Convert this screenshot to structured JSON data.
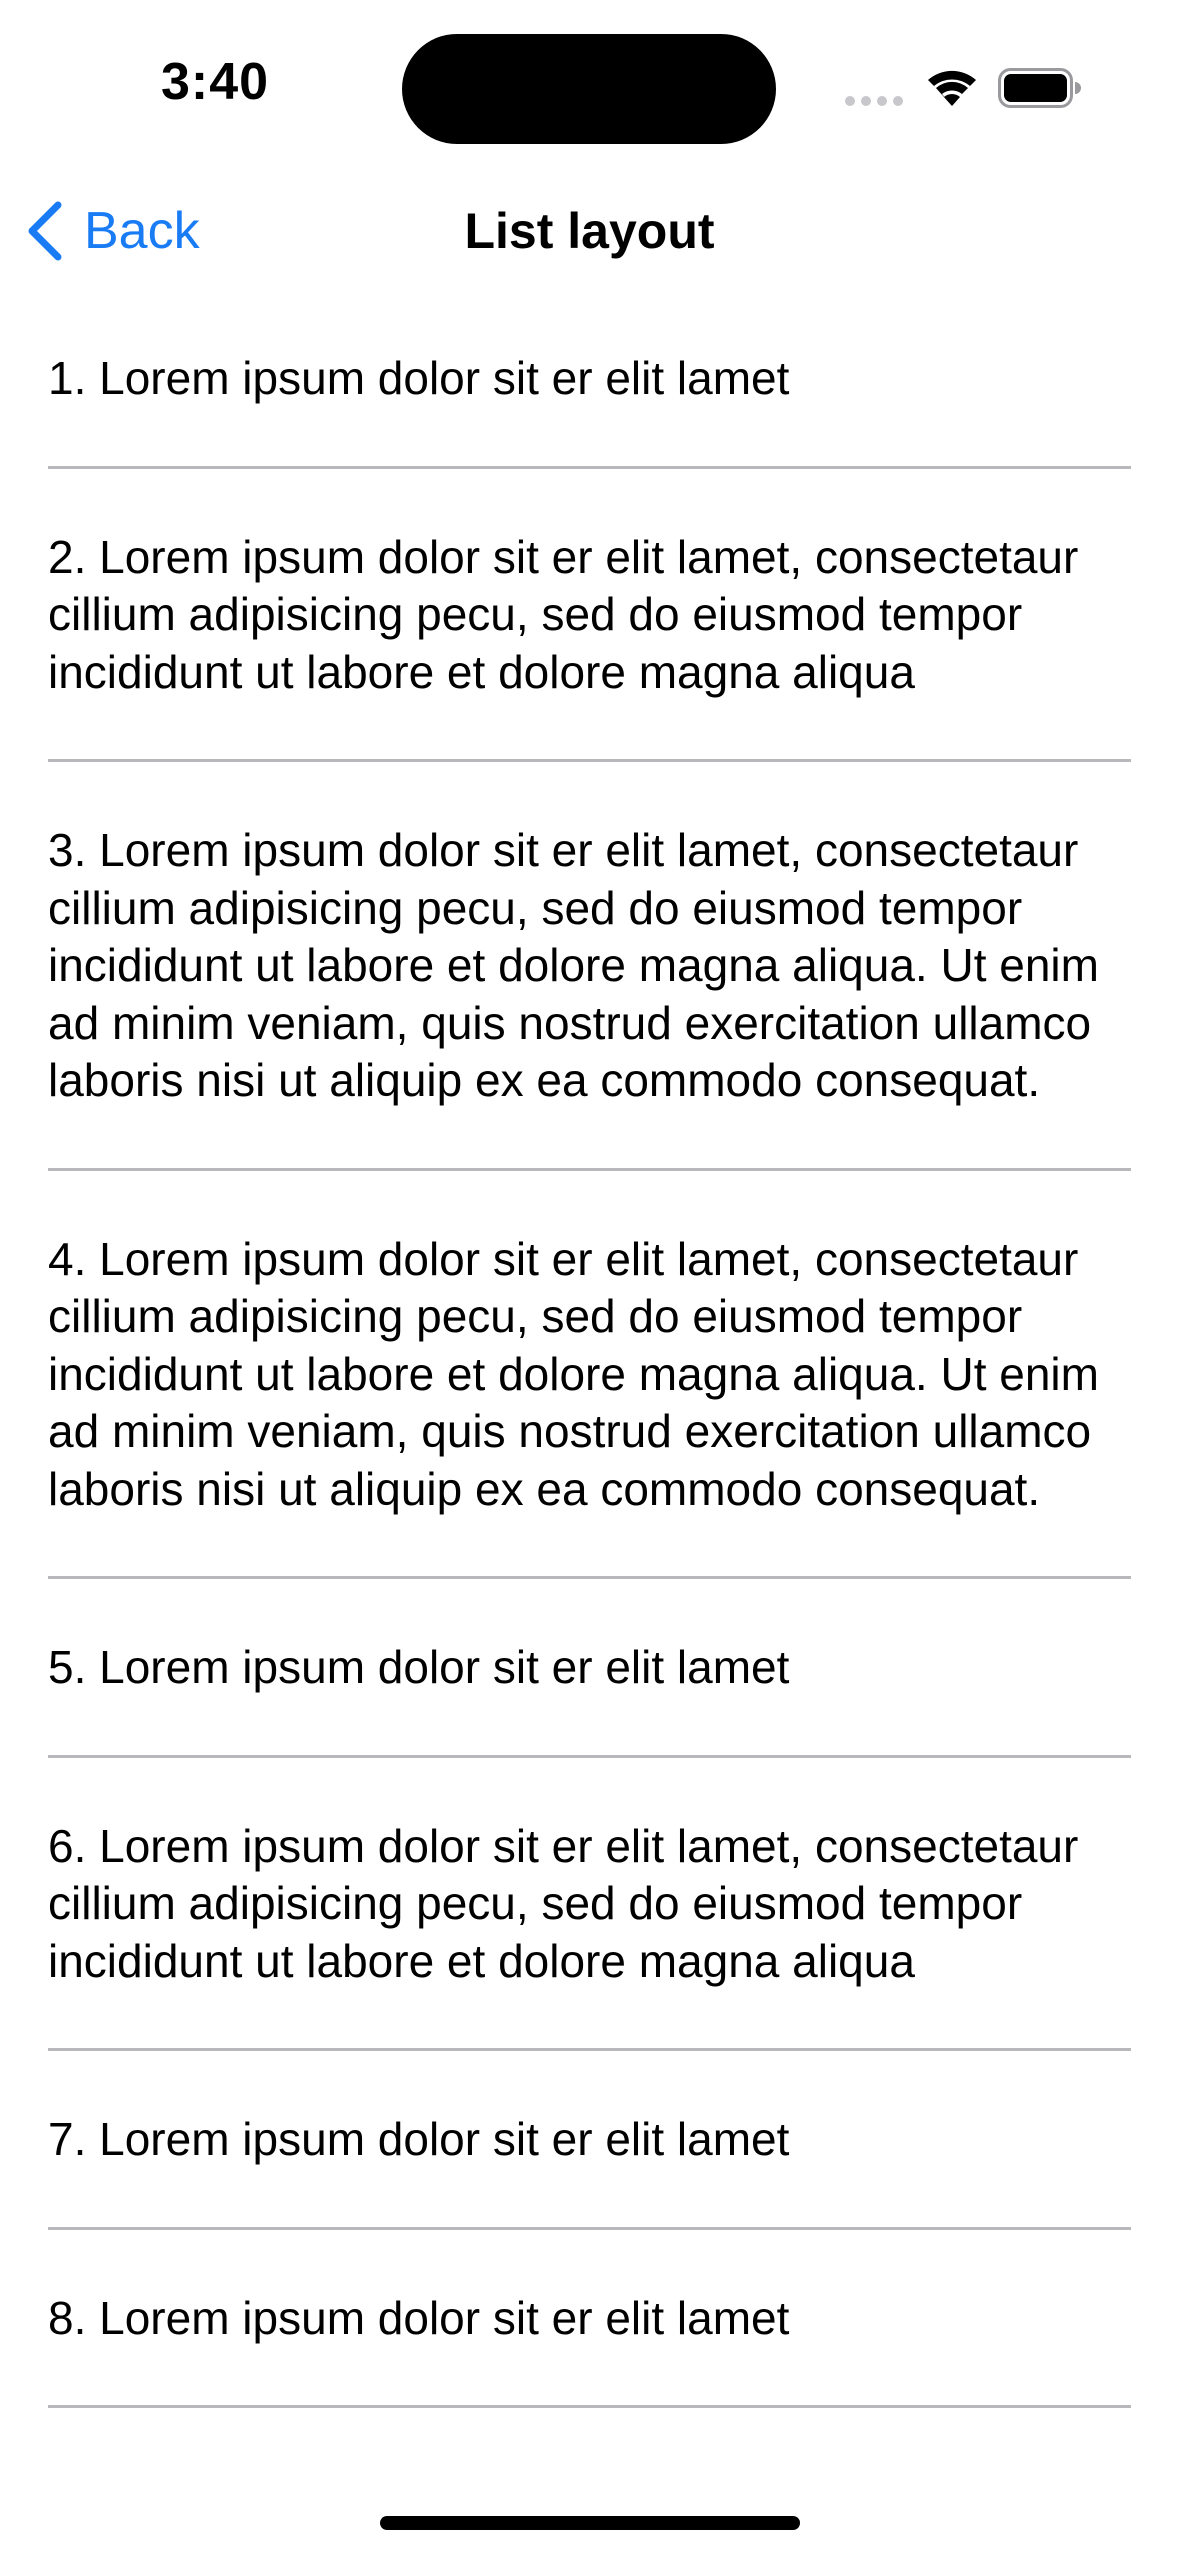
{
  "status_bar": {
    "time": "3:40"
  },
  "nav": {
    "back_label": "Back",
    "title": "List layout"
  },
  "list": {
    "items": [
      "1. Lorem ipsum dolor sit er elit lamet",
      "2. Lorem ipsum dolor sit er elit lamet, consectetaur cillium adipisicing pecu, sed do eiusmod tempor incididunt ut labore et dolore magna aliqua",
      "3. Lorem ipsum dolor sit er elit lamet, consectetaur cillium adipisicing pecu, sed do eiusmod tempor incididunt ut labore et dolore magna aliqua. Ut enim ad minim veniam, quis nostrud exercitation ullamco laboris nisi ut aliquip ex ea commodo consequat.",
      "4. Lorem ipsum dolor sit er elit lamet, consectetaur cillium adipisicing pecu, sed do eiusmod tempor incididunt ut labore et dolore magna aliqua. Ut enim ad minim veniam, quis nostrud exercitation ullamco laboris nisi ut aliquip ex ea commodo consequat.",
      "5. Lorem ipsum dolor sit er elit lamet",
      "6. Lorem ipsum dolor sit er elit lamet, consectetaur cillium adipisicing pecu, sed do eiusmod tempor incididunt ut labore et dolore magna aliqua",
      "7. Lorem ipsum dolor sit er elit lamet",
      "8. Lorem ipsum dolor sit er elit lamet"
    ]
  },
  "icons": {
    "back": "chevron-left-icon",
    "wifi": "wifi-icon",
    "battery": "battery-icon",
    "signal": "cellular-signal-icon"
  },
  "colors": {
    "accent": "#1a7cf5",
    "separator": "#b8b8bc",
    "text": "#000000",
    "background": "#ffffff"
  }
}
